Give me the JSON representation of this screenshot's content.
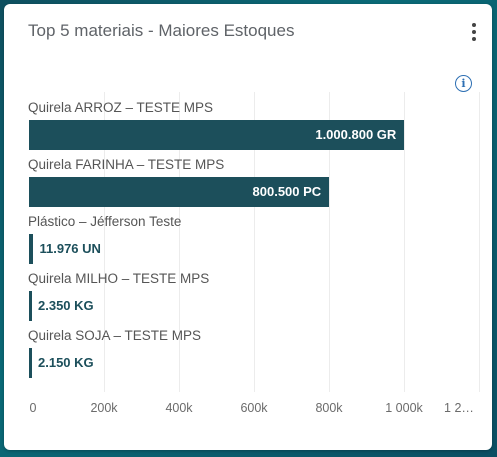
{
  "widget": {
    "title": "Top 5 materiais - Maiores Estoques",
    "menu_icon": "kebab-menu-icon",
    "info_icon": "info-icon",
    "info_glyph": "i"
  },
  "colors": {
    "bar": "#1c4f5b",
    "background": "#0a6a77"
  },
  "chart_data": {
    "type": "bar",
    "orientation": "horizontal",
    "categories": [
      "Quirela ARROZ – TESTE MPS",
      "Quirela FARINHA – TESTE MPS",
      "Plástico – Jéfferson Teste",
      "Quirela MILHO – TESTE MPS",
      "Quirela SOJA – TESTE MPS"
    ],
    "values": [
      1000800,
      800500,
      11976,
      2350,
      2150
    ],
    "value_labels": [
      "1.000.800 GR",
      "800.500 PC",
      "11.976 UN",
      "2.350 KG",
      "2.150 KG"
    ],
    "xlim": [
      0,
      1200000
    ],
    "x_ticks": [
      0,
      200000,
      400000,
      600000,
      800000,
      1000000,
      1200000
    ],
    "x_tick_labels": [
      "0",
      "200k",
      "400k",
      "600k",
      "800k",
      "1 000k",
      "1 2…"
    ],
    "grid": true
  }
}
